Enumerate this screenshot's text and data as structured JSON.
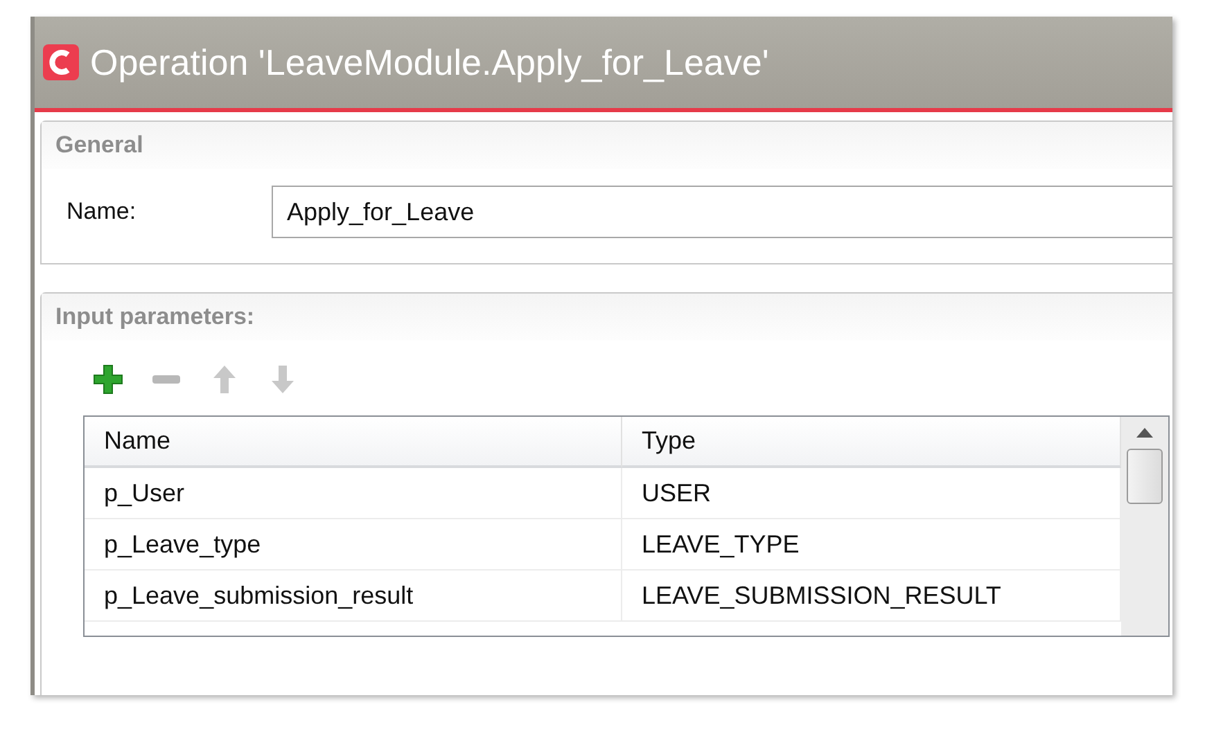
{
  "window": {
    "title": "Operation 'LeaveModule.Apply_for_Leave'"
  },
  "general": {
    "heading": "General",
    "name_label": "Name:",
    "name_value": "Apply_for_Leave"
  },
  "input_parameters": {
    "heading": "Input parameters:",
    "toolbar": [
      {
        "kind": "add",
        "disabled": false
      },
      {
        "kind": "remove",
        "disabled": true
      },
      {
        "kind": "up",
        "disabled": true
      },
      {
        "kind": "down",
        "disabled": true
      }
    ],
    "table": {
      "columns": [
        "Name",
        "Type"
      ],
      "rows": [
        {
          "cells": [
            "p_User",
            "USER"
          ]
        },
        {
          "cells": [
            "p_Leave_type",
            "LEAVE_TYPE"
          ]
        },
        {
          "cells": [
            "p_Leave_submission_result",
            "LEAVE_SUBMISSION_RESULT"
          ]
        }
      ]
    }
  }
}
